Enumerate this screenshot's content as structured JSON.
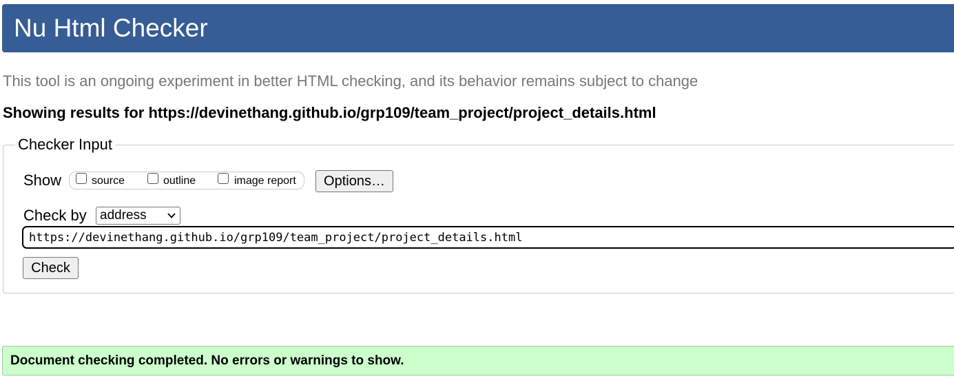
{
  "header": {
    "title": "Nu Html Checker"
  },
  "tagline": "This tool is an ongoing experiment in better HTML checking, and its behavior remains subject to change",
  "results_heading": "Showing results for https://devinethang.github.io/grp109/team_project/project_details.html",
  "checker_input": {
    "legend": "Checker Input",
    "show_label": "Show",
    "show_options": [
      {
        "label": "source",
        "checked": false
      },
      {
        "label": "outline",
        "checked": false
      },
      {
        "label": "image report",
        "checked": false
      }
    ],
    "options_button": "Options…",
    "check_by_label": "Check by",
    "check_by_selected": "address",
    "url_value": "https://devinethang.github.io/grp109/team_project/project_details.html",
    "check_button": "Check"
  },
  "status": {
    "message": "Document checking completed. No errors or warnings to show."
  },
  "colors": {
    "header_bg": "#365d95",
    "success_bg": "#ccffcc",
    "tagline_text": "#777777"
  },
  "icons": {
    "select_chevron": "chevron-down-icon"
  }
}
